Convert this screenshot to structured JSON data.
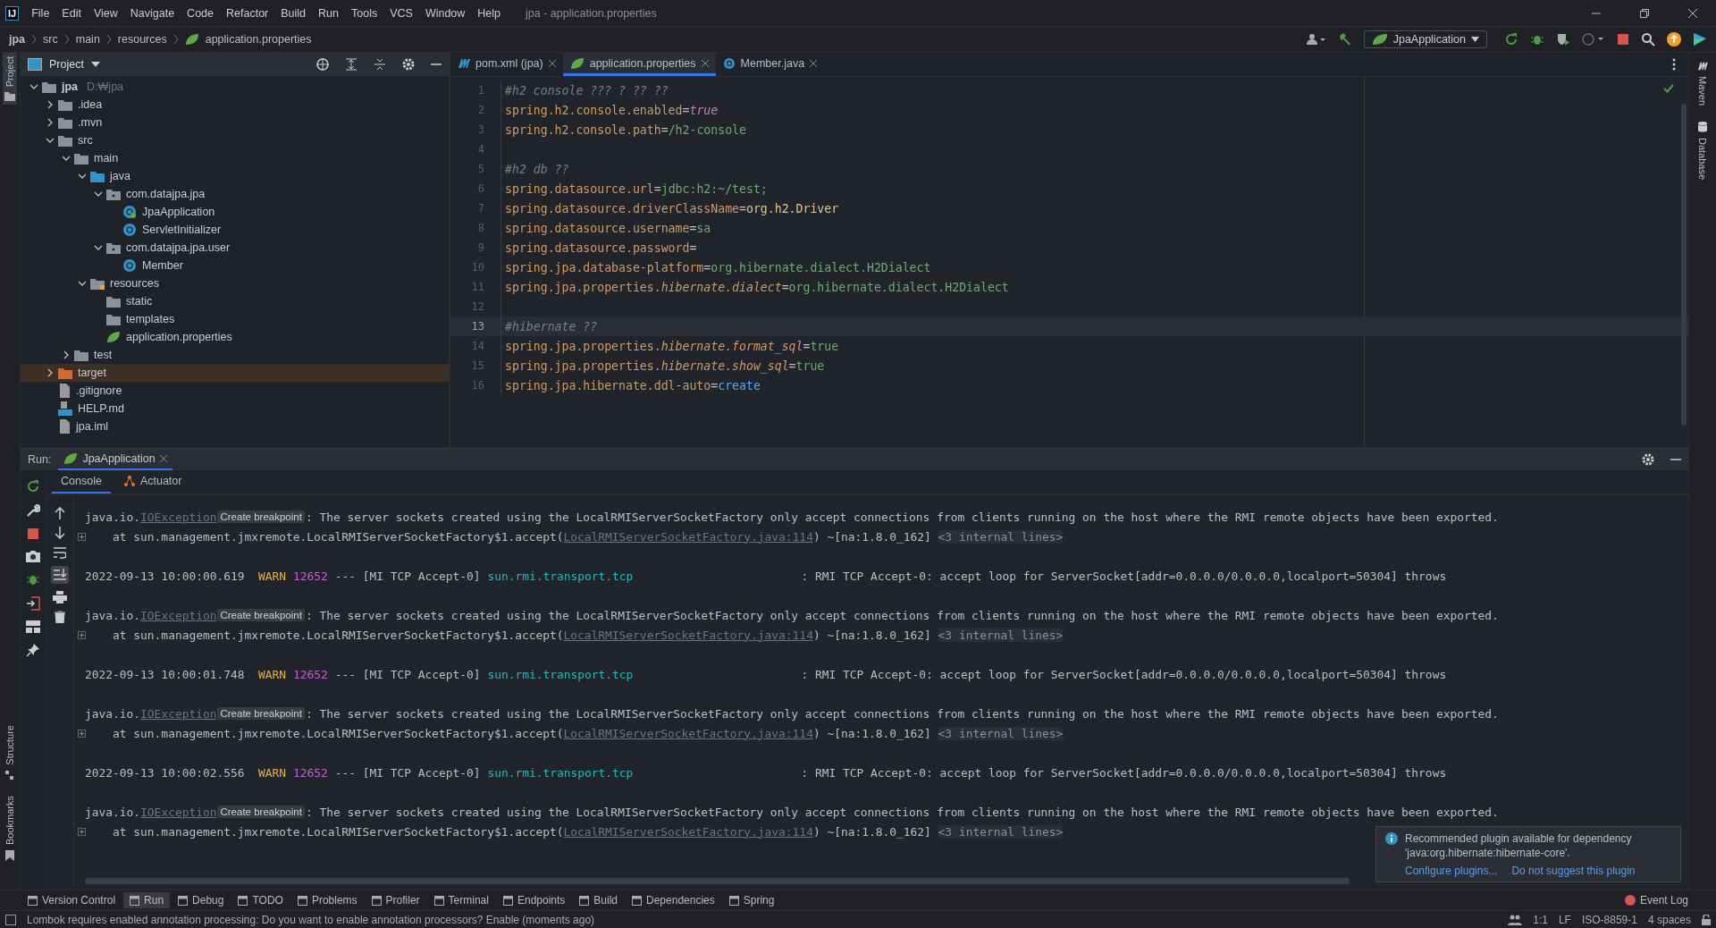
{
  "app_logo": "IJ",
  "menu": [
    "File",
    "Edit",
    "View",
    "Navigate",
    "Code",
    "Refactor",
    "Build",
    "Run",
    "Tools",
    "VCS",
    "Window",
    "Help"
  ],
  "window_title": "jpa - application.properties",
  "breadcrumb": [
    "jpa",
    "src",
    "main",
    "resources",
    "application.properties"
  ],
  "run_config": "JpaApplication",
  "left_stripe": [
    "Project",
    "Structure",
    "Bookmarks"
  ],
  "right_stripe": [
    "Maven",
    "Database"
  ],
  "project": {
    "title": "Project",
    "tree": [
      {
        "label": "jpa",
        "hint": "D:₩jpa",
        "kind": "module",
        "expanded": true,
        "selected": false,
        "children": [
          {
            "label": ".idea",
            "kind": "folder",
            "expanded": false,
            "selected": false
          },
          {
            "label": ".mvn",
            "kind": "folder",
            "expanded": false,
            "selected": false
          },
          {
            "label": "src",
            "kind": "folder",
            "expanded": true,
            "selected": false,
            "children": [
              {
                "label": "main",
                "kind": "folder",
                "expanded": true,
                "selected": false,
                "children": [
                  {
                    "label": "java",
                    "kind": "source",
                    "expanded": true,
                    "selected": false,
                    "children": [
                      {
                        "label": "com.datajpa.jpa",
                        "kind": "package",
                        "expanded": true,
                        "selected": false,
                        "children": [
                          {
                            "label": "JpaApplication",
                            "kind": "app-class",
                            "selected": false
                          },
                          {
                            "label": "ServletInitializer",
                            "kind": "class",
                            "selected": false
                          }
                        ]
                      },
                      {
                        "label": "com.datajpa.jpa.user",
                        "kind": "package",
                        "expanded": true,
                        "selected": false,
                        "children": [
                          {
                            "label": "Member",
                            "kind": "class",
                            "selected": false
                          }
                        ]
                      }
                    ]
                  },
                  {
                    "label": "resources",
                    "kind": "resources",
                    "expanded": true,
                    "selected": false,
                    "children": [
                      {
                        "label": "static",
                        "kind": "folder",
                        "selected": false
                      },
                      {
                        "label": "templates",
                        "kind": "folder",
                        "selected": false
                      },
                      {
                        "label": "application.properties",
                        "kind": "spring",
                        "selected": false
                      }
                    ]
                  }
                ]
              },
              {
                "label": "test",
                "kind": "folder",
                "expanded": false,
                "selected": false
              }
            ]
          },
          {
            "label": "target",
            "kind": "excluded",
            "expanded": false,
            "selected": true
          },
          {
            "label": ".gitignore",
            "kind": "file",
            "selected": false
          },
          {
            "label": "HELP.md",
            "kind": "markdown",
            "selected": false
          },
          {
            "label": "jpa.iml",
            "kind": "file",
            "selected": false
          }
        ]
      }
    ]
  },
  "editor_tabs": [
    {
      "label": "pom.xml (jpa)",
      "kind": "maven",
      "selected": false
    },
    {
      "label": "application.properties",
      "kind": "spring",
      "selected": true
    },
    {
      "label": "Member.java",
      "kind": "class",
      "selected": false
    }
  ],
  "code": [
    {
      "number": "1",
      "current": false,
      "tokens": [
        {
          "text": "#h2 console ??? ? ?? ??",
          "kind": "comment"
        }
      ]
    },
    {
      "number": "2",
      "current": false,
      "tokens": [
        {
          "text": "spring.h2.console.enabled",
          "kind": "key"
        },
        {
          "text": "=",
          "kind": "op"
        },
        {
          "text": "true",
          "kind": "keyword"
        }
      ]
    },
    {
      "number": "3",
      "current": false,
      "tokens": [
        {
          "text": "spring.h2.console.path",
          "kind": "key"
        },
        {
          "text": "=",
          "kind": "op"
        },
        {
          "text": "/h2-console",
          "kind": "value"
        }
      ]
    },
    {
      "number": "4",
      "current": false
    },
    {
      "number": "5",
      "current": false,
      "tokens": [
        {
          "text": "#h2 db ??",
          "kind": "comment"
        }
      ]
    },
    {
      "number": "6",
      "current": false,
      "tokens": [
        {
          "text": "spring.datasource.url",
          "kind": "key"
        },
        {
          "text": "=",
          "kind": "op"
        },
        {
          "text": "jdbc:h2:~/test;",
          "kind": "value"
        }
      ]
    },
    {
      "number": "7",
      "current": false,
      "tokens": [
        {
          "text": "spring.datasource.driverClassName",
          "kind": "key"
        },
        {
          "text": "=",
          "kind": "op"
        },
        {
          "text": "org.h2.Driver",
          "kind": "class"
        }
      ]
    },
    {
      "number": "8",
      "current": false,
      "tokens": [
        {
          "text": "spring.datasource.username",
          "kind": "key"
        },
        {
          "text": "=",
          "kind": "op"
        },
        {
          "text": "sa",
          "kind": "value"
        }
      ]
    },
    {
      "number": "9",
      "current": false,
      "tokens": [
        {
          "text": "spring.datasource.password",
          "kind": "key"
        },
        {
          "text": "=",
          "kind": "op"
        }
      ]
    },
    {
      "number": "10",
      "current": false,
      "tokens": [
        {
          "text": "spring.jpa.database-platform",
          "kind": "key"
        },
        {
          "text": "=",
          "kind": "op"
        },
        {
          "text": "org.hibernate.dialect.H2Dialect",
          "kind": "value"
        }
      ]
    },
    {
      "number": "11",
      "current": false,
      "tokens": [
        {
          "text": "spring.jpa.properties.",
          "kind": "key"
        },
        {
          "text": "hibernate.dialect",
          "kind": "key-italic"
        },
        {
          "text": "=",
          "kind": "op"
        },
        {
          "text": "org.hibernate.dialect.H2Dialect",
          "kind": "value"
        }
      ]
    },
    {
      "number": "12",
      "current": false
    },
    {
      "number": "13",
      "current": true,
      "tokens": [
        {
          "text": "#hibernate ??",
          "kind": "comment"
        }
      ]
    },
    {
      "number": "14",
      "current": false,
      "tokens": [
        {
          "text": "spring.jpa.properties.",
          "kind": "key"
        },
        {
          "text": "hibernate.format_sql",
          "kind": "key-italic"
        },
        {
          "text": "=",
          "kind": "op"
        },
        {
          "text": "true",
          "kind": "value"
        }
      ]
    },
    {
      "number": "15",
      "current": false,
      "tokens": [
        {
          "text": "spring.jpa.properties.",
          "kind": "key"
        },
        {
          "text": "hibernate.show_sql",
          "kind": "key-italic"
        },
        {
          "text": "=",
          "kind": "op"
        },
        {
          "text": "true",
          "kind": "value"
        }
      ]
    },
    {
      "number": "16",
      "current": false,
      "tokens": [
        {
          "text": "spring.jpa.hibernate.ddl-auto",
          "kind": "key"
        },
        {
          "text": "=",
          "kind": "op"
        },
        {
          "text": "create",
          "kind": "enum"
        }
      ]
    }
  ],
  "run": {
    "label": "Run:",
    "tab": "JpaApplication",
    "tabs": [
      {
        "label": "Console",
        "selected": true
      },
      {
        "label": "Actuator",
        "selected": false
      }
    ],
    "entries": [
      {
        "lines": [
          {
            "foldable": false,
            "tokens": [
              {
                "text": "java.io.",
                "kind": "plain"
              },
              {
                "text": "IOException",
                "kind": "link"
              },
              {
                "text": "Create breakpoint",
                "kind": "badge"
              },
              {
                "text": ": The server sockets created using the LocalRMIServerSocketFactory only accept connections from clients running on the host where the RMI remote objects have been exported.",
                "kind": "plain"
              }
            ]
          },
          {
            "foldable": true,
            "tokens": [
              {
                "text": "    at sun.management.jmxremote.LocalRMIServerSocketFactory$1.accept(",
                "kind": "plain"
              },
              {
                "text": "LocalRMIServerSocketFactory.java:114",
                "kind": "link"
              },
              {
                "text": ") ~[na:1.8.0_162] ",
                "kind": "plain"
              },
              {
                "text": "<3 internal lines>",
                "kind": "fold"
              }
            ]
          }
        ]
      },
      {
        "lines": [
          {
            "foldable": false,
            "tokens": [
              {
                "text": "2022-09-13 10:00:00.619  ",
                "kind": "plain"
              },
              {
                "text": "WARN",
                "kind": "warn"
              },
              {
                "text": "12652",
                "kind": "pid"
              },
              {
                "text": " --- [MI TCP Accept-0] ",
                "kind": "plain"
              },
              {
                "text": "sun.rmi.transport.tcp",
                "kind": "logger"
              },
              {
                "text": ": RMI TCP Accept-0: accept loop for ServerSocket[addr=0.0.0.0/0.0.0.0,localport=50304] throws",
                "kind": "plain"
              }
            ]
          }
        ]
      },
      {
        "lines": [
          {
            "foldable": false,
            "tokens": [
              {
                "text": "java.io.",
                "kind": "plain"
              },
              {
                "text": "IOException",
                "kind": "link"
              },
              {
                "text": "Create breakpoint",
                "kind": "badge"
              },
              {
                "text": ": The server sockets created using the LocalRMIServerSocketFactory only accept connections from clients running on the host where the RMI remote objects have been exported.",
                "kind": "plain"
              }
            ]
          },
          {
            "foldable": true,
            "tokens": [
              {
                "text": "    at sun.management.jmxremote.LocalRMIServerSocketFactory$1.accept(",
                "kind": "plain"
              },
              {
                "text": "LocalRMIServerSocketFactory.java:114",
                "kind": "link"
              },
              {
                "text": ") ~[na:1.8.0_162] ",
                "kind": "plain"
              },
              {
                "text": "<3 internal lines>",
                "kind": "fold"
              }
            ]
          }
        ]
      },
      {
        "lines": [
          {
            "foldable": false,
            "tokens": [
              {
                "text": "2022-09-13 10:00:01.748  ",
                "kind": "plain"
              },
              {
                "text": "WARN",
                "kind": "warn"
              },
              {
                "text": "12652",
                "kind": "pid"
              },
              {
                "text": " --- [MI TCP Accept-0] ",
                "kind": "plain"
              },
              {
                "text": "sun.rmi.transport.tcp",
                "kind": "logger"
              },
              {
                "text": ": RMI TCP Accept-0: accept loop for ServerSocket[addr=0.0.0.0/0.0.0.0,localport=50304] throws",
                "kind": "plain"
              }
            ]
          }
        ]
      },
      {
        "lines": [
          {
            "foldable": false,
            "tokens": [
              {
                "text": "java.io.",
                "kind": "plain"
              },
              {
                "text": "IOException",
                "kind": "link"
              },
              {
                "text": "Create breakpoint",
                "kind": "badge"
              },
              {
                "text": ": The server sockets created using the LocalRMIServerSocketFactory only accept connections from clients running on the host where the RMI remote objects have been exported.",
                "kind": "plain"
              }
            ]
          },
          {
            "foldable": true,
            "tokens": [
              {
                "text": "    at sun.management.jmxremote.LocalRMIServerSocketFactory$1.accept(",
                "kind": "plain"
              },
              {
                "text": "LocalRMIServerSocketFactory.java:114",
                "kind": "link"
              },
              {
                "text": ") ~[na:1.8.0_162] ",
                "kind": "plain"
              },
              {
                "text": "<3 internal lines>",
                "kind": "fold"
              }
            ]
          }
        ]
      },
      {
        "lines": [
          {
            "foldable": false,
            "tokens": [
              {
                "text": "2022-09-13 10:00:02.556  ",
                "kind": "plain"
              },
              {
                "text": "WARN",
                "kind": "warn"
              },
              {
                "text": "12652",
                "kind": "pid"
              },
              {
                "text": " --- [MI TCP Accept-0] ",
                "kind": "plain"
              },
              {
                "text": "sun.rmi.transport.tcp",
                "kind": "logger"
              },
              {
                "text": ": RMI TCP Accept-0: accept loop for ServerSocket[addr=0.0.0.0/0.0.0.0,localport=50304] throws",
                "kind": "plain"
              }
            ]
          }
        ]
      },
      {
        "lines": [
          {
            "foldable": false,
            "tokens": [
              {
                "text": "java.io.",
                "kind": "plain"
              },
              {
                "text": "IOException",
                "kind": "link"
              },
              {
                "text": "Create breakpoint",
                "kind": "badge"
              },
              {
                "text": ": The server sockets created using the LocalRMIServerSocketFactory only accept connections from clients running on the host where the RMI remote objects have been exported.",
                "kind": "plain"
              }
            ]
          },
          {
            "foldable": true,
            "tokens": [
              {
                "text": "    at sun.management.jmxremote.LocalRMIServerSocketFactory$1.accept(",
                "kind": "plain"
              },
              {
                "text": "LocalRMIServerSocketFactory.java:114",
                "kind": "link"
              },
              {
                "text": ") ~[na:1.8.0_162] ",
                "kind": "plain"
              },
              {
                "text": "<3 internal lines>",
                "kind": "fold"
              }
            ]
          }
        ]
      }
    ]
  },
  "notification": {
    "text": "Recommended plugin available for dependency 'java:org.hibernate:hibernate-core'.",
    "actions": [
      "Configure plugins...",
      "Do not suggest this plugin"
    ]
  },
  "tool_windows": [
    {
      "label": "Version Control",
      "selected": false
    },
    {
      "label": "Run",
      "selected": true
    },
    {
      "label": "Debug",
      "selected": false
    },
    {
      "label": "TODO",
      "selected": false
    },
    {
      "label": "Problems",
      "selected": false
    },
    {
      "label": "Profiler",
      "selected": false
    },
    {
      "label": "Terminal",
      "selected": false
    },
    {
      "label": "Endpoints",
      "selected": false
    },
    {
      "label": "Build",
      "selected": false
    },
    {
      "label": "Dependencies",
      "selected": false
    },
    {
      "label": "Spring",
      "selected": false
    }
  ],
  "event_log": "Event Log",
  "status": {
    "message": "Lombok requires enabled annotation processing: Do you want to enable annotation processors? Enable (moments ago)",
    "items": [
      "1:1",
      "LF",
      "ISO-8859-1",
      "4 spaces"
    ]
  }
}
